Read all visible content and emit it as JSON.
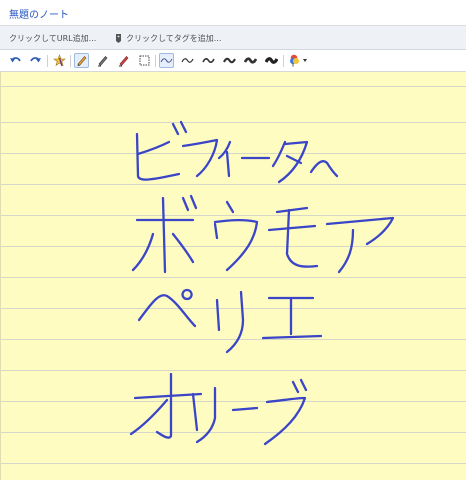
{
  "note": {
    "title": "無題のノート"
  },
  "meta_bar": {
    "url_placeholder": "クリックしてURL追加...",
    "tag_placeholder": "クリックしてタグを追加..."
  },
  "toolbar": {
    "tools": [
      {
        "name": "undo-icon",
        "active": false
      },
      {
        "name": "redo-icon",
        "active": false
      },
      {
        "name": "highlighter-star-icon",
        "active": false
      },
      {
        "name": "pencil-icon",
        "active": true
      },
      {
        "name": "pen-icon",
        "active": false
      },
      {
        "name": "eraser-icon",
        "active": false
      },
      {
        "name": "selection-icon",
        "active": false
      },
      {
        "name": "stroke-thin-icon",
        "active": true
      },
      {
        "name": "stroke-medium-icon",
        "active": false
      },
      {
        "name": "stroke-thick-icon",
        "active": false
      },
      {
        "name": "stroke-thicker-icon",
        "active": false
      },
      {
        "name": "stroke-thickest-icon",
        "active": false
      },
      {
        "name": "color-picker-icon",
        "active": false
      }
    ]
  },
  "colors": {
    "paper": "#fffcc2",
    "ruled_line": "#d5d8c8",
    "ink": "#3a45c8",
    "title_text": "#2a57c4"
  },
  "handwriting": {
    "lines": [
      "ビフィーター",
      "ボウモア",
      "ペリエ",
      "オリーブ"
    ]
  }
}
